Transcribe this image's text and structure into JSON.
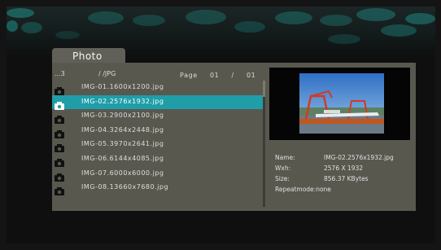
{
  "tab": {
    "label": "Photo"
  },
  "path": {
    "count": "...3",
    "directory": "/ /JPG"
  },
  "pager": {
    "label": "Page",
    "current": "01",
    "separator": "/",
    "total": "01"
  },
  "files": [
    {
      "name": "IMG-01.1600x1200.jpg",
      "selected": false
    },
    {
      "name": "IMG-02.2576x1932.jpg",
      "selected": true
    },
    {
      "name": "IMG-03.2900x2100.jpg",
      "selected": false
    },
    {
      "name": "IMG-04.3264x2448.jpg",
      "selected": false
    },
    {
      "name": "IMG-05.3970x2641.jpg",
      "selected": false
    },
    {
      "name": "IMG-06.6144x4085.jpg",
      "selected": false
    },
    {
      "name": "IMG-07.6000x6000.jpg",
      "selected": false
    },
    {
      "name": "IMG-08.13660x7680.jpg",
      "selected": false
    }
  ],
  "file_icon": "camera-icon",
  "info": {
    "name_label": "Name:",
    "name_value": "IMG-02.2576x1932.jpg",
    "wxh_label": "Wxh:",
    "wxh_value": "2576 X 1932",
    "size_label": "Size:",
    "size_value": "856.37 KBytes",
    "repeat_label": "Repeatmode:",
    "repeat_value": "none"
  },
  "colors": {
    "panel": "#58584f",
    "tab": "#606058",
    "selection": "#1f9ea8",
    "background": "#0f0f0f",
    "decor": "#1f8f88"
  }
}
